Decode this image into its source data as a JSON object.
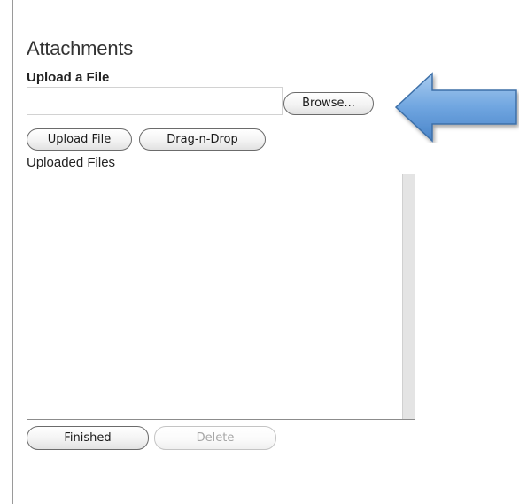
{
  "attachments": {
    "title": "Attachments",
    "upload_heading": "Upload a File",
    "file_input": {
      "value": "",
      "placeholder": ""
    },
    "browse_label": "Browse...",
    "upload_file_label": "Upload File",
    "drag_drop_label": "Drag-n-Drop",
    "uploaded_files_label": "Uploaded Files",
    "uploaded_files": [],
    "finished_label": "Finished",
    "delete_label": "Delete"
  },
  "annotation": {
    "icon": "arrow-left-icon",
    "color": "#5b9bd5"
  }
}
